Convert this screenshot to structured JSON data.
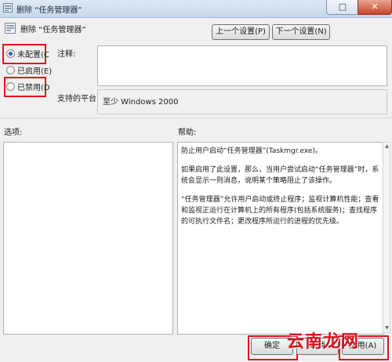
{
  "window": {
    "title": "删除 “任务管理器”",
    "minimize_glyph": "–",
    "maximize_glyph": "□",
    "close_glyph": "✕"
  },
  "policy": {
    "name": "删除 “任务管理器”"
  },
  "nav": {
    "prev_label": "上一个设置(P)",
    "next_label": "下一个设置(N)"
  },
  "state": {
    "options": [
      {
        "label": "未配置(C",
        "checked": true
      },
      {
        "label": "已启用(E)",
        "checked": false
      },
      {
        "label": "已禁用(D",
        "checked": false
      }
    ]
  },
  "comment": {
    "label": "注释:",
    "value": ""
  },
  "platform": {
    "label": "支持的平台:",
    "value": "至少 Windows 2000"
  },
  "sections": {
    "options_label": "选项:",
    "help_label": "帮助:"
  },
  "help": {
    "paragraphs": [
      "防止用户启动“任务管理器”(Taskmgr.exe)。",
      "如果启用了此设置，那么，当用户尝试启动“任务管理器”时，系统会显示一则消息，说明某个策略阻止了该操作。",
      "“任务管理器”允许用户启动或终止程序；监视计算机性能；查看和监视正运行在计算机上的所有程序(包括系统服务)；查找程序的可执行文件名；更改程序所运行的进程的优先级。"
    ]
  },
  "footer": {
    "ok_label": "确定",
    "cancel_label": "取消",
    "apply_label": "应用(A)"
  },
  "watermark": {
    "text": "云南龙网"
  },
  "colors": {
    "highlight": "#e0141e",
    "watermark": "#d3141e"
  }
}
